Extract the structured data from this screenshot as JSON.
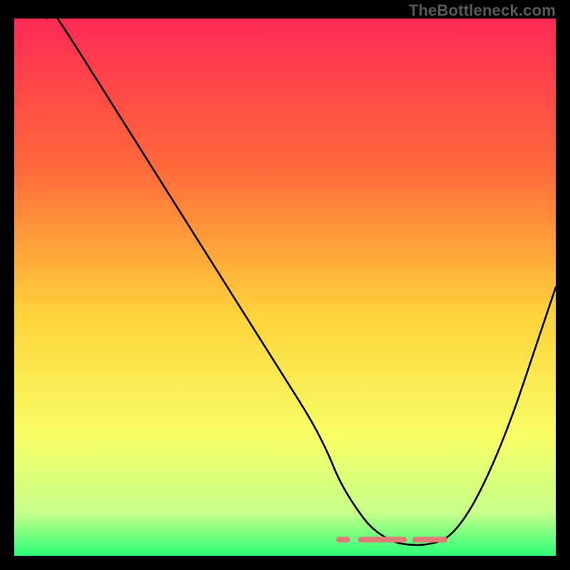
{
  "watermark": "TheBottleneck.com",
  "colors": {
    "gradient": [
      {
        "offset": "0%",
        "color": "#ff2a55"
      },
      {
        "offset": "28%",
        "color": "#ff6a3a"
      },
      {
        "offset": "55%",
        "color": "#ffd23a"
      },
      {
        "offset": "78%",
        "color": "#f7ff66"
      },
      {
        "offset": "92%",
        "color": "#c6ff8a"
      },
      {
        "offset": "100%",
        "color": "#2bff77"
      }
    ],
    "curve_stroke": "#000000",
    "trough_marker": "#e07878",
    "background": "#000000",
    "watermark": "#5a5a5a"
  },
  "chart_data": {
    "type": "line",
    "title": "",
    "xlabel": "",
    "ylabel": "",
    "xlim": [
      0,
      100
    ],
    "ylim": [
      0,
      100
    ],
    "x": [
      6,
      10,
      15,
      20,
      25,
      30,
      35,
      40,
      45,
      50,
      55,
      58,
      60,
      63,
      66,
      70,
      73,
      76,
      80,
      84,
      88,
      92,
      96,
      100
    ],
    "values": [
      103,
      97,
      89,
      81,
      73,
      65,
      57,
      49,
      41,
      33,
      25,
      19,
      14,
      9,
      5,
      2.5,
      2,
      2,
      3,
      8,
      16,
      26,
      38,
      50
    ],
    "optimal_zone": {
      "x_start": 60,
      "x_end": 80,
      "y": 3
    },
    "grid": false,
    "legend": false
  }
}
